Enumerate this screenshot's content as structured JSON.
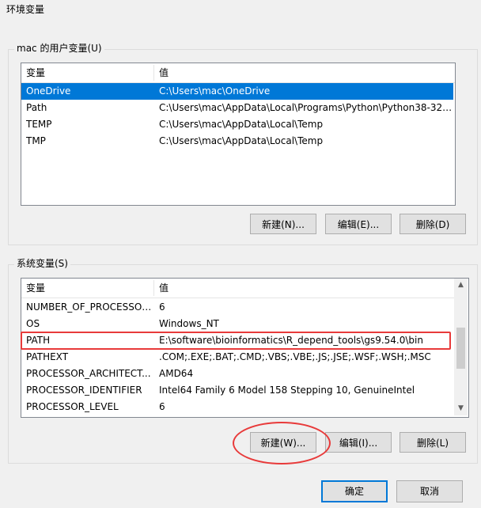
{
  "window": {
    "title": "环境变量"
  },
  "user_group": {
    "label": "mac 的用户变量(U)",
    "columns": [
      "变量",
      "值"
    ],
    "rows": [
      {
        "name": "OneDrive",
        "value": "C:\\Users\\mac\\OneDrive",
        "selected": true
      },
      {
        "name": "Path",
        "value": "C:\\Users\\mac\\AppData\\Local\\Programs\\Python\\Python38-32\\..."
      },
      {
        "name": "TEMP",
        "value": "C:\\Users\\mac\\AppData\\Local\\Temp"
      },
      {
        "name": "TMP",
        "value": "C:\\Users\\mac\\AppData\\Local\\Temp"
      }
    ],
    "buttons": {
      "new": "新建(N)...",
      "edit": "编辑(E)...",
      "delete": "删除(D)"
    }
  },
  "system_group": {
    "label": "系统变量(S)",
    "columns": [
      "变量",
      "值"
    ],
    "rows": [
      {
        "name": "NUMBER_OF_PROCESSORS",
        "value": "6"
      },
      {
        "name": "OS",
        "value": "Windows_NT"
      },
      {
        "name": "PATH",
        "value": "E:\\software\\bioinformatics\\R_depend_tools\\gs9.54.0\\bin",
        "highlighted": true
      },
      {
        "name": "PATHEXT",
        "value": ".COM;.EXE;.BAT;.CMD;.VBS;.VBE;.JS;.JSE;.WSF;.WSH;.MSC"
      },
      {
        "name": "PROCESSOR_ARCHITECT...",
        "value": "AMD64"
      },
      {
        "name": "PROCESSOR_IDENTIFIER",
        "value": "Intel64 Family 6 Model 158 Stepping 10, GenuineIntel"
      },
      {
        "name": "PROCESSOR_LEVEL",
        "value": "6"
      }
    ],
    "buttons": {
      "new": "新建(W)...",
      "edit": "编辑(I)...",
      "delete": "删除(L)"
    }
  },
  "footer": {
    "ok": "确定",
    "cancel": "取消"
  },
  "colors": {
    "selection": "#0078d7",
    "annotation": "#e83a3a"
  }
}
